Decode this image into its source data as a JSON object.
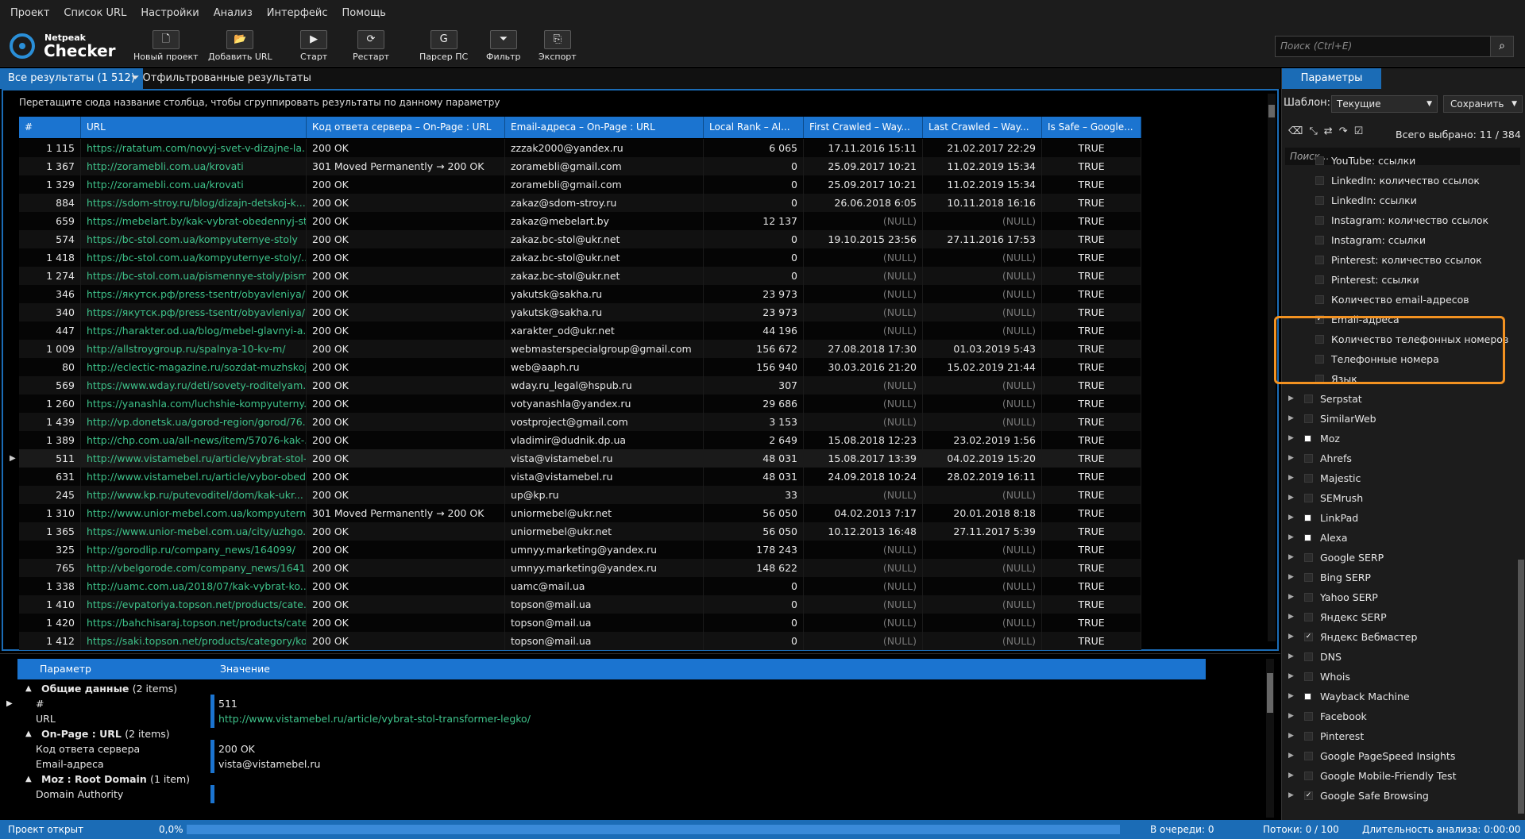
{
  "menu": [
    "Проект",
    "Список URL",
    "Настройки",
    "Анализ",
    "Интерфейс",
    "Помощь"
  ],
  "logo": {
    "line1": "Netpeak",
    "line2": "Checker"
  },
  "toolbar": [
    {
      "label": "Новый проект",
      "icon": "new-project-icon",
      "glyph": "🗋"
    },
    {
      "label": "Добавить URL",
      "icon": "folder-icon",
      "glyph": "📂"
    },
    {
      "label": "Старт",
      "icon": "play-icon",
      "glyph": "▶"
    },
    {
      "label": "Рестарт",
      "icon": "restart-icon",
      "glyph": "⟳"
    },
    {
      "label": "Парсер ПС",
      "icon": "google-icon",
      "glyph": "G"
    },
    {
      "label": "Фильтр",
      "icon": "filter-icon",
      "glyph": "⏷"
    },
    {
      "label": "Экспорт",
      "icon": "export-icon",
      "glyph": "⎘"
    }
  ],
  "search": {
    "placeholder": "Поиск (Ctrl+E)"
  },
  "tabs": {
    "all": "Все результаты (1 512)",
    "filtered": "Отфильтрованные результаты"
  },
  "grid": {
    "group_hint": "Перетащите сюда название столбца, чтобы сгруппировать результаты по данному параметру",
    "columns": [
      "#",
      "URL",
      "Код ответа сервера – On-Page : URL",
      "Email-адреса – On-Page : URL",
      "Local Rank – Al...",
      "First Crawled – Way...",
      "Last Crawled – Way...",
      "Is Safe – Google..."
    ],
    "rows": [
      [
        "1 115",
        "https://ratatum.com/novyj-svet-v-dizajne-la...",
        "200 OK",
        "zzzak2000@yandex.ru",
        "6 065",
        "17.11.2016 15:11",
        "21.02.2017 22:29",
        "TRUE"
      ],
      [
        "1 367",
        "http://zoramebli.com.ua/krovati",
        "301 Moved Permanently → 200 OK",
        "zoramebli@gmail.com",
        "0",
        "25.09.2017 10:21",
        "11.02.2019 15:34",
        "TRUE"
      ],
      [
        "1 329",
        "http://zoramebli.com.ua/krovati",
        "200 OK",
        "zoramebli@gmail.com",
        "0",
        "25.09.2017 10:21",
        "11.02.2019 15:34",
        "TRUE"
      ],
      [
        "884",
        "https://sdom-stroy.ru/blog/dizajn-detskoj-k...",
        "200 OK",
        "zakaz@sdom-stroy.ru",
        "0",
        "26.06.2018 6:05",
        "10.11.2018 16:16",
        "TRUE"
      ],
      [
        "659",
        "https://mebelart.by/kak-vybrat-obedennyj-st...",
        "200 OK",
        "zakaz@mebelart.by",
        "12 137",
        "(NULL)",
        "(NULL)",
        "TRUE"
      ],
      [
        "574",
        "https://bc-stol.com.ua/kompyuternye-stoly",
        "200 OK",
        "zakaz.bc-stol@ukr.net",
        "0",
        "19.10.2015 23:56",
        "27.11.2016 17:53",
        "TRUE"
      ],
      [
        "1 418",
        "https://bc-stol.com.ua/kompyuternye-stoly/...",
        "200 OK",
        "zakaz.bc-stol@ukr.net",
        "0",
        "(NULL)",
        "(NULL)",
        "TRUE"
      ],
      [
        "1 274",
        "https://bc-stol.com.ua/pismennye-stoly/pism...",
        "200 OK",
        "zakaz.bc-stol@ukr.net",
        "0",
        "(NULL)",
        "(NULL)",
        "TRUE"
      ],
      [
        "346",
        "https://якутск.рф/press-tsentr/obyavleniya/?...",
        "200 OK",
        "yakutsk@sakha.ru",
        "23 973",
        "(NULL)",
        "(NULL)",
        "TRUE"
      ],
      [
        "340",
        "https://якутск.рф/press-tsentr/obyavleniya/?...",
        "200 OK",
        "yakutsk@sakha.ru",
        "23 973",
        "(NULL)",
        "(NULL)",
        "TRUE"
      ],
      [
        "447",
        "https://harakter.od.ua/blog/mebel-glavnyi-a...",
        "200 OK",
        "xarakter_od@ukr.net",
        "44 196",
        "(NULL)",
        "(NULL)",
        "TRUE"
      ],
      [
        "1 009",
        "http://allstroygroup.ru/spalnya-10-kv-m/",
        "200 OK",
        "webmasterspecialgroup@gmail.com",
        "156 672",
        "27.08.2018 17:30",
        "01.03.2019 5:43",
        "TRUE"
      ],
      [
        "80",
        "http://eclectic-magazine.ru/sozdat-muzhskoj...",
        "200 OK",
        "web@aaph.ru",
        "156 940",
        "30.03.2016 21:20",
        "15.02.2019 21:44",
        "TRUE"
      ],
      [
        "569",
        "https://www.wday.ru/deti/sovety-roditelyam...",
        "200 OK",
        "wday.ru_legal@hspub.ru",
        "307",
        "(NULL)",
        "(NULL)",
        "TRUE"
      ],
      [
        "1 260",
        "https://yanashla.com/luchshie-kompyuterny...",
        "200 OK",
        "votyanashla@yandex.ru",
        "29 686",
        "(NULL)",
        "(NULL)",
        "TRUE"
      ],
      [
        "1 439",
        "http://vp.donetsk.ua/gorod-region/gorod/76...",
        "200 OK",
        "vostproject@gmail.com",
        "3 153",
        "(NULL)",
        "(NULL)",
        "TRUE"
      ],
      [
        "1 389",
        "http://chp.com.ua/all-news/item/57076-kak-...",
        "200 OK",
        "vladimir@dudnik.dp.ua",
        "2 649",
        "15.08.2018 12:23",
        "23.02.2019 1:56",
        "TRUE"
      ],
      [
        "511",
        "http://www.vistamebel.ru/article/vybrat-stol-...",
        "200 OK",
        "vista@vistamebel.ru",
        "48 031",
        "15.08.2017 13:39",
        "04.02.2019 15:20",
        "TRUE"
      ],
      [
        "631",
        "http://www.vistamebel.ru/article/vybor-obed...",
        "200 OK",
        "vista@vistamebel.ru",
        "48 031",
        "24.09.2018 10:24",
        "28.02.2019 16:11",
        "TRUE"
      ],
      [
        "245",
        "http://www.kp.ru/putevoditel/dom/kak-ukr...",
        "200 OK",
        "up@kp.ru",
        "33",
        "(NULL)",
        "(NULL)",
        "TRUE"
      ],
      [
        "1 310",
        "http://www.unior-mebel.com.ua/kompyutern...",
        "301 Moved Permanently → 200 OK",
        "uniormebel@ukr.net",
        "56 050",
        "04.02.2013 7:17",
        "20.01.2018 8:18",
        "TRUE"
      ],
      [
        "1 365",
        "https://www.unior-mebel.com.ua/city/uzhgo...",
        "200 OK",
        "uniormebel@ukr.net",
        "56 050",
        "10.12.2013 16:48",
        "27.11.2017 5:39",
        "TRUE"
      ],
      [
        "325",
        "http://gorodlip.ru/company_news/164099/",
        "200 OK",
        "umnyy.marketing@yandex.ru",
        "178 243",
        "(NULL)",
        "(NULL)",
        "TRUE"
      ],
      [
        "765",
        "http://vbelgorode.com/company_news/1641...",
        "200 OK",
        "umnyy.marketing@yandex.ru",
        "148 622",
        "(NULL)",
        "(NULL)",
        "TRUE"
      ],
      [
        "1 338",
        "http://uamc.com.ua/2018/07/kak-vybrat-ko...",
        "200 OK",
        "uamc@mail.ua",
        "0",
        "(NULL)",
        "(NULL)",
        "TRUE"
      ],
      [
        "1 410",
        "https://evpatoriya.topson.net/products/cate...",
        "200 OK",
        "topson@mail.ua",
        "0",
        "(NULL)",
        "(NULL)",
        "TRUE"
      ],
      [
        "1 420",
        "https://bahchisaraj.topson.net/products/cate...",
        "200 OK",
        "topson@mail.ua",
        "0",
        "(NULL)",
        "(NULL)",
        "TRUE"
      ],
      [
        "1 412",
        "https://saki.topson.net/products/category/ko...",
        "200 OK",
        "topson@mail.ua",
        "0",
        "(NULL)",
        "(NULL)",
        "TRUE"
      ]
    ]
  },
  "details": {
    "col_param": "Параметр",
    "col_value": "Значение",
    "groups": [
      {
        "name": "Общие данные",
        "count": "(2 items)"
      },
      {
        "name": "On-Page : URL",
        "count": "(2 items)"
      },
      {
        "name": "Moz : Root Domain",
        "count": "(1 item)"
      }
    ],
    "items": [
      {
        "k": "#",
        "v": "511"
      },
      {
        "k": "URL",
        "v": "http://www.vistamebel.ru/article/vybrat-stol-transformer-legko/"
      },
      {
        "k": "Код ответа сервера",
        "v": "200 OK"
      },
      {
        "k": "Email-адреса",
        "v": "vista@vistamebel.ru"
      },
      {
        "k": "Domain Authority",
        "v": ""
      }
    ]
  },
  "params": {
    "tab": "Параметры",
    "template_label": "Шаблон:",
    "template_value": "Текущие",
    "save": "Сохранить",
    "total": "Всего выбрано: 11 / 384",
    "search_placeholder": "Поиск...",
    "sub": [
      {
        "label": "YouTube: ссылки",
        "checked": false
      },
      {
        "label": "LinkedIn: количество ссылок",
        "checked": false
      },
      {
        "label": "LinkedIn: ссылки",
        "checked": false
      },
      {
        "label": "Instagram: количество ссылок",
        "checked": false
      },
      {
        "label": "Instagram: ссылки",
        "checked": false
      },
      {
        "label": "Pinterest: количество ссылок",
        "checked": false
      },
      {
        "label": "Pinterest: ссылки",
        "checked": false
      },
      {
        "label": "Количество email-адресов",
        "checked": false
      },
      {
        "label": "Email-адреса",
        "checked": true
      },
      {
        "label": "Количество телефонных номеров",
        "checked": false
      },
      {
        "label": "Телефонные номера",
        "checked": false
      },
      {
        "label": "Язык",
        "checked": false
      }
    ],
    "groups": [
      {
        "label": "Serpstat",
        "state": "off"
      },
      {
        "label": "SimilarWeb",
        "state": "off"
      },
      {
        "label": "Moz",
        "state": "partial"
      },
      {
        "label": "Ahrefs",
        "state": "off"
      },
      {
        "label": "Majestic",
        "state": "off"
      },
      {
        "label": "SEMrush",
        "state": "off"
      },
      {
        "label": "LinkPad",
        "state": "partial"
      },
      {
        "label": "Alexa",
        "state": "partial"
      },
      {
        "label": "Google SERP",
        "state": "off"
      },
      {
        "label": "Bing SERP",
        "state": "off"
      },
      {
        "label": "Yahoo SERP",
        "state": "off"
      },
      {
        "label": "Яндекс SERP",
        "state": "off"
      },
      {
        "label": "Яндекс Вебмастер",
        "state": "on"
      },
      {
        "label": "DNS",
        "state": "off"
      },
      {
        "label": "Whois",
        "state": "off"
      },
      {
        "label": "Wayback Machine",
        "state": "partial"
      },
      {
        "label": "Facebook",
        "state": "off"
      },
      {
        "label": "Pinterest",
        "state": "off"
      },
      {
        "label": "Google PageSpeed Insights",
        "state": "off"
      },
      {
        "label": "Google Mobile-Friendly Test",
        "state": "off"
      },
      {
        "label": "Google Safe Browsing",
        "state": "on"
      }
    ]
  },
  "status": {
    "project": "Проект открыт",
    "progress": "0,0%",
    "progress_value": 0,
    "queue": "В очереди: 0",
    "threads": "Потоки: 0 / 100",
    "duration": "Длительность анализа: 0:00:00"
  },
  "colors": {
    "accent": "#1b6cb6",
    "url": "#3ec28a",
    "highlight": "#f39221"
  }
}
